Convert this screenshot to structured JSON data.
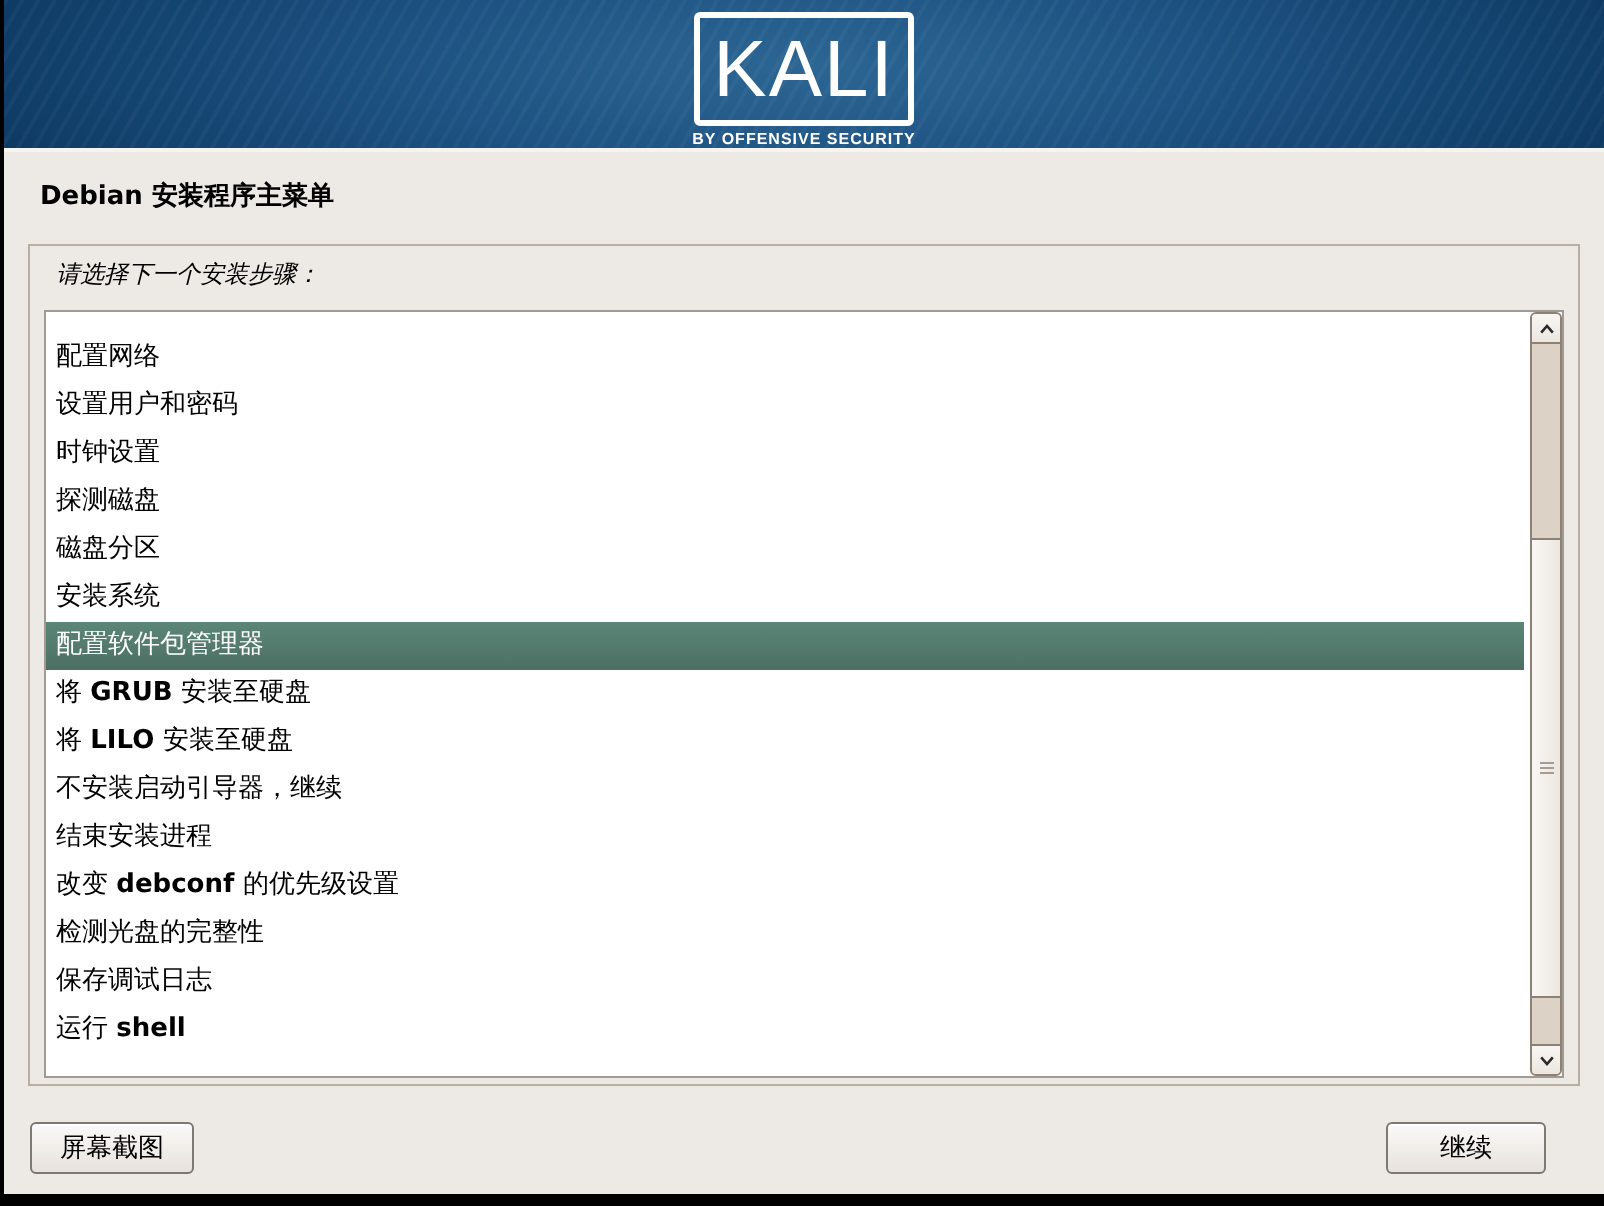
{
  "header": {
    "logo_text": "KALI",
    "tagline": "BY OFFENSIVE SECURITY"
  },
  "title": "Debian 安装程序主菜单",
  "prompt": "请选择下一个安装步骤：",
  "steps": [
    {
      "label": "配置网络",
      "selected": false
    },
    {
      "label": "设置用户和密码",
      "selected": false
    },
    {
      "label": "时钟设置",
      "selected": false
    },
    {
      "label": "探测磁盘",
      "selected": false
    },
    {
      "label": "磁盘分区",
      "selected": false
    },
    {
      "label": "安装系统",
      "selected": false
    },
    {
      "label": "配置软件包管理器",
      "selected": true
    },
    {
      "label": "将 **GRUB** 安装至硬盘",
      "selected": false
    },
    {
      "label": "将 **LILO** 安装至硬盘",
      "selected": false
    },
    {
      "label": "不安装启动引导器，继续",
      "selected": false
    },
    {
      "label": "结束安装进程",
      "selected": false
    },
    {
      "label": "改变 **debconf** 的优先级设置",
      "selected": false
    },
    {
      "label": "检测光盘的完整性",
      "selected": false
    },
    {
      "label": "保存调试日志",
      "selected": false
    },
    {
      "label": "运行 **shell**",
      "selected": false
    }
  ],
  "buttons": [
    "屏幕截图",
    "继续"
  ]
}
